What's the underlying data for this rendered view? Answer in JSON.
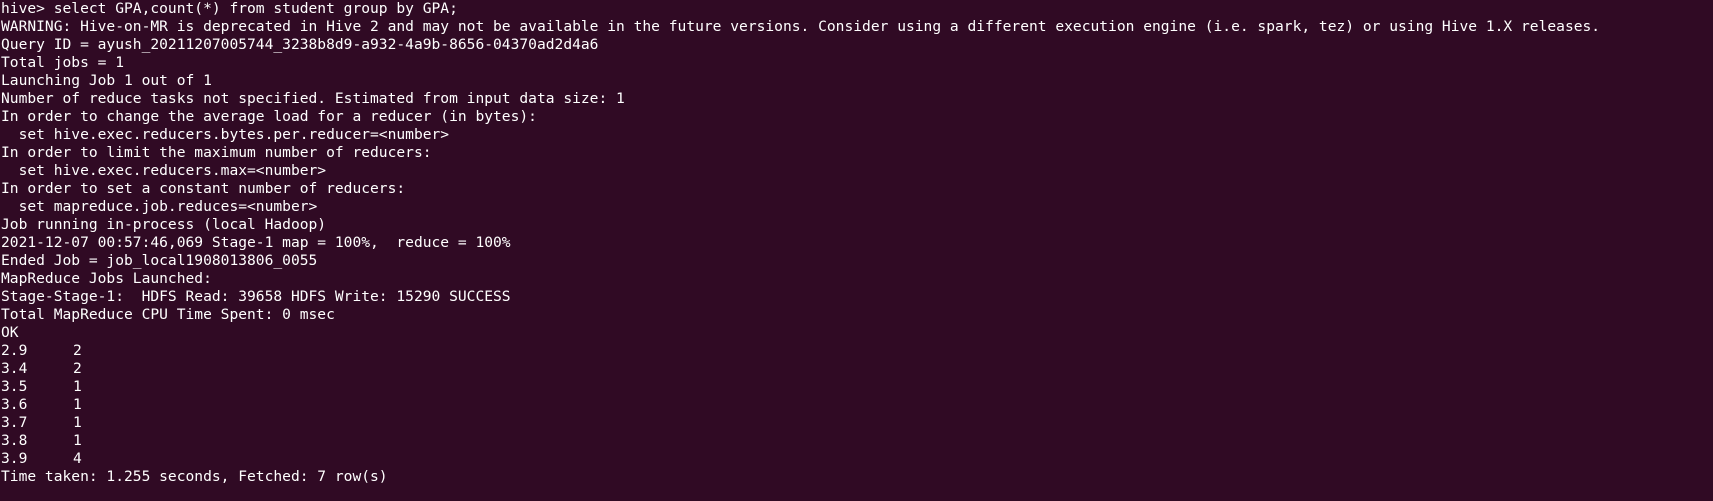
{
  "terminal": {
    "prompt_line": "hive> select GPA,count(*) from student group by GPA;",
    "log_lines": [
      "WARNING: Hive-on-MR is deprecated in Hive 2 and may not be available in the future versions. Consider using a different execution engine (i.e. spark, tez) or using Hive 1.X releases.",
      "Query ID = ayush_20211207005744_3238b8d9-a932-4a9b-8656-04370ad2d4a6",
      "Total jobs = 1",
      "Launching Job 1 out of 1",
      "Number of reduce tasks not specified. Estimated from input data size: 1",
      "In order to change the average load for a reducer (in bytes):",
      "  set hive.exec.reducers.bytes.per.reducer=<number>",
      "In order to limit the maximum number of reducers:",
      "  set hive.exec.reducers.max=<number>",
      "In order to set a constant number of reducers:",
      "  set mapreduce.job.reduces=<number>",
      "Job running in-process (local Hadoop)",
      "2021-12-07 00:57:46,069 Stage-1 map = 100%,  reduce = 100%",
      "Ended Job = job_local1908013806_0055",
      "MapReduce Jobs Launched:",
      "Stage-Stage-1:  HDFS Read: 39658 HDFS Write: 15290 SUCCESS",
      "Total MapReduce CPU Time Spent: 0 msec",
      "OK"
    ],
    "result_rows": [
      {
        "gpa": "2.9",
        "count": "2"
      },
      {
        "gpa": "3.4",
        "count": "2"
      },
      {
        "gpa": "3.5",
        "count": "1"
      },
      {
        "gpa": "3.6",
        "count": "1"
      },
      {
        "gpa": "3.7",
        "count": "1"
      },
      {
        "gpa": "3.8",
        "count": "1"
      },
      {
        "gpa": "3.9",
        "count": "4"
      }
    ],
    "summary_line": "Time taken: 1.255 seconds, Fetched: 7 row(s)",
    "colors": {
      "background": "#300a24",
      "foreground": "#ffffff"
    }
  }
}
